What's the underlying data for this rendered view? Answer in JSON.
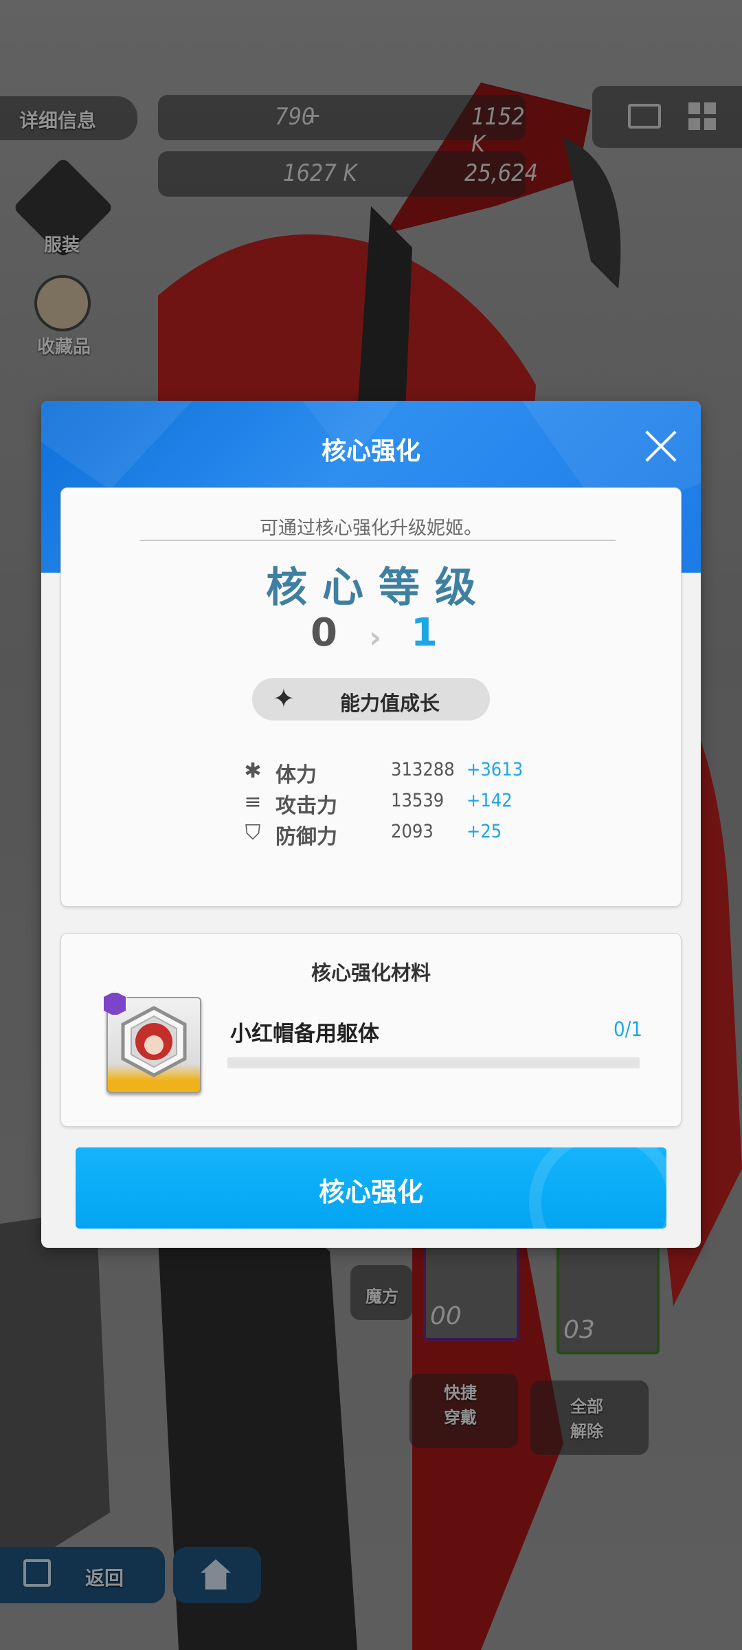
{
  "background": {
    "details_tab": "详细信息",
    "resources": [
      "790",
      "1152 K",
      "1627 K",
      "25,624"
    ],
    "side_menu": [
      "服装",
      "收藏品"
    ],
    "bottom_buttons": [
      "快捷\n穿戴",
      "全部\n解除",
      "魔方"
    ],
    "back_label": "返回",
    "slot_levels": [
      "00",
      "03"
    ]
  },
  "modal": {
    "title": "核心强化",
    "description": "可通过核心强化升级妮姬。",
    "core_heading": "核心等级",
    "level_from": "0",
    "level_to": "1",
    "growth_label": "能力值成长",
    "stats": [
      {
        "icon": "hp-icon",
        "name": "体力",
        "value": "313288",
        "increase": "+3613"
      },
      {
        "icon": "attack-icon",
        "name": "攻击力",
        "value": "13539",
        "increase": "+142"
      },
      {
        "icon": "defense-icon",
        "name": "防御力",
        "value": "2093",
        "increase": "+25"
      }
    ],
    "material_title": "核心强化材料",
    "material_name": "小红帽备用躯体",
    "material_count": "0/1",
    "material_progress": 0,
    "confirm_label": "核心强化"
  },
  "colors": {
    "accent": "#1ea6e4",
    "header_blue": "#1c7be6",
    "button_blue": "#04a4f2",
    "heading_teal": "#3f7fa0",
    "rarity_purple": "#7b44c9"
  }
}
